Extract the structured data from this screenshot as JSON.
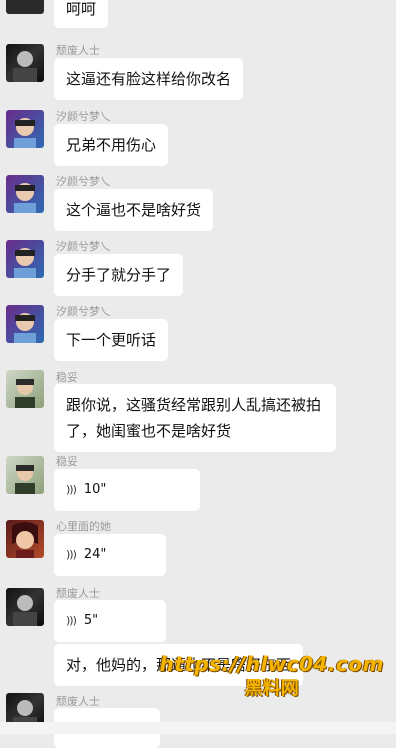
{
  "messages": [
    {
      "name": "",
      "text": "呵呵"
    },
    {
      "name": "颓废人士",
      "text": "这逼还有脸这样给你改名"
    },
    {
      "name": "汐颜兮梦乀",
      "text": "兄弟不用伤心"
    },
    {
      "name": "汐颜兮梦乀",
      "text": "这个逼也不是啥好货"
    },
    {
      "name": "汐颜兮梦乀",
      "text": "分手了就分手了"
    },
    {
      "name": "汐颜兮梦乀",
      "text": "下一个更听话"
    },
    {
      "name": "稳妥",
      "text": "跟你说，这骚货经常跟别人乱搞还被拍了，她闺蜜也不是啥好货"
    },
    {
      "name": "稳妥",
      "voice": "10\""
    },
    {
      "name": "心里面的她",
      "voice": "24\""
    },
    {
      "name": "颓废人士",
      "voice": "5\""
    },
    {
      "name": "",
      "text": "对，他妈的，那逼也不是啥好东西"
    },
    {
      "name": "颓废人士",
      "text": ""
    }
  ],
  "watermark": {
    "line1": "https://hlwc04.com",
    "line2": "黑料网"
  }
}
